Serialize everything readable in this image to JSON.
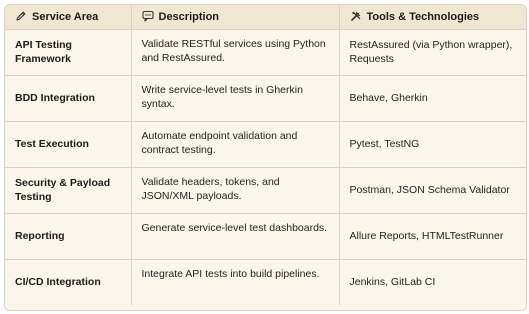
{
  "table": {
    "headers": [
      {
        "label": "Service Area",
        "icon": "pen-icon"
      },
      {
        "label": "Description",
        "icon": "speech-bubble-icon"
      },
      {
        "label": "Tools & Technologies",
        "icon": "tools-icon"
      }
    ],
    "rows": [
      {
        "area": "API Testing Framework",
        "description": "Validate RESTful services using Python and RestAssured.",
        "tools": "RestAssured (via Python wrapper), Requests"
      },
      {
        "area": "BDD Integration",
        "description": "Write service-level tests in Gherkin syntax.",
        "tools": "Behave, Gherkin"
      },
      {
        "area": "Test Execution",
        "description": "Automate endpoint validation and contract testing.",
        "tools": "Pytest, TestNG"
      },
      {
        "area": "Security & Payload Testing",
        "description": "Validate headers, tokens, and JSON/XML payloads.",
        "tools": "Postman, JSON Schema Validator"
      },
      {
        "area": "Reporting",
        "description": "Generate service-level test dashboards.",
        "tools": "Allure Reports, HTMLTestRunner"
      },
      {
        "area": "CI/CD Integration",
        "description": "Integrate API tests into build pipelines.",
        "tools": "Jenkins, GitLab CI"
      }
    ]
  },
  "colors": {
    "header_bg": "#f0e7d2",
    "body_bg": "#fbf6ea",
    "border": "#d9d2c4"
  }
}
